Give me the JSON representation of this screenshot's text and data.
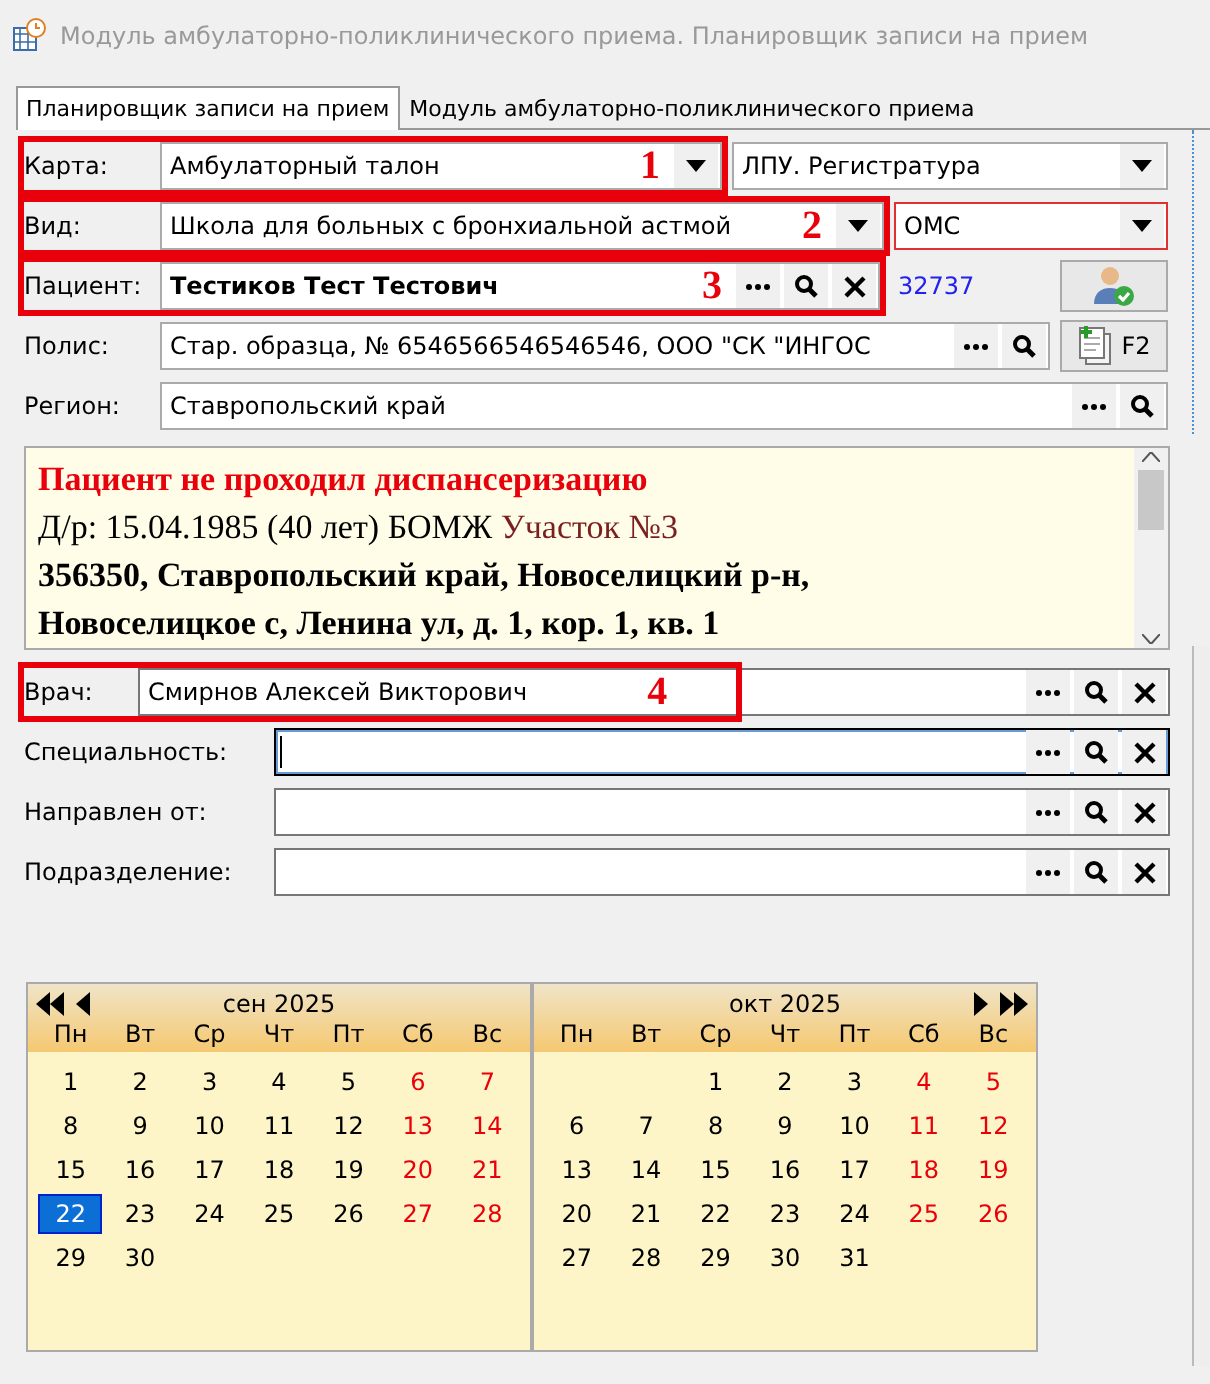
{
  "window": {
    "title": "Модуль амбулаторно-поликлинического приема. Планировщик записи на прием"
  },
  "tabs": [
    {
      "label": "Планировщик записи на прием",
      "selected": true
    },
    {
      "label": "Модуль амбулаторно-поликлинического приема",
      "selected": false
    }
  ],
  "top_rows": [
    {
      "label": "Карта:",
      "kind": "combo",
      "value": "Амбулаторный талон",
      "bold": false,
      "marker": "1",
      "buttons": [],
      "side": {
        "kind": "combo",
        "value": "ЛПУ. Регистратура",
        "error": false
      }
    },
    {
      "label": "Вид:",
      "kind": "combo",
      "value": "Школа для больных с бронхиальной астмой",
      "bold": false,
      "marker": "2",
      "buttons": [],
      "side": {
        "kind": "combo",
        "value": "ОМС",
        "error": true
      }
    },
    {
      "label": "Пациент:",
      "kind": "lookup",
      "value": "Тестиков Тест Тестович",
      "bold": true,
      "marker": "3",
      "buttons": [
        {
          "kind": "more"
        },
        {
          "kind": "search"
        },
        {
          "kind": "clear"
        }
      ],
      "side": {
        "kind": "link_button",
        "value": "32737"
      }
    },
    {
      "label": "Полис:",
      "kind": "lookup",
      "value": "Стар. образца, № 6546566546546546, ООО \"СК \"ИНГОС",
      "bold": false,
      "buttons": [
        {
          "kind": "more"
        },
        {
          "kind": "search"
        }
      ],
      "side": {
        "kind": "key_button",
        "value": "F2"
      }
    },
    {
      "label": "Регион:",
      "kind": "lookup",
      "value": "Ставропольский край",
      "bold": false,
      "buttons": [
        {
          "kind": "more"
        },
        {
          "kind": "search"
        }
      ]
    }
  ],
  "info": {
    "warning": "Пациент не проходил диспансеризацию",
    "birth": "Д/р: 15.04.1985 (40 лет) БОМЖ",
    "district": "Участок №3",
    "address": "356350, Ставропольский край, Новоселицкий р-н, Новоселицкое с, Ленина ул, д. 1, кор. 1, кв. 1"
  },
  "doctor_rows": [
    {
      "label": "Врач:",
      "value": "Смирнов Алексей Викторович",
      "marker": "4",
      "focused": false,
      "buttons": [
        {
          "kind": "more"
        },
        {
          "kind": "search"
        },
        {
          "kind": "clear"
        }
      ]
    },
    {
      "label": "Специальность:",
      "focused": true,
      "buttons": [
        {
          "kind": "more"
        },
        {
          "kind": "search"
        },
        {
          "kind": "clear"
        }
      ]
    },
    {
      "label": "Направлен от:",
      "focused": false,
      "buttons": [
        {
          "kind": "more"
        },
        {
          "kind": "search"
        },
        {
          "kind": "clear"
        }
      ]
    },
    {
      "label": "Подразделение:",
      "focused": false,
      "buttons": [
        {
          "kind": "more"
        },
        {
          "kind": "search"
        },
        {
          "kind": "clear"
        }
      ]
    }
  ],
  "calendar": {
    "months": [
      {
        "title": "сен 2025",
        "prev_buttons": true,
        "next_buttons": false,
        "weekdays": [
          "Пн",
          "Вт",
          "Ср",
          "Чт",
          "Пт",
          "Сб",
          "Вс"
        ],
        "weeks": [
          [
            {
              "day": "1",
              "selected": false
            },
            {
              "day": "2",
              "selected": false
            },
            {
              "day": "3",
              "selected": false
            },
            {
              "day": "4",
              "selected": false
            },
            {
              "day": "5",
              "selected": false
            },
            {
              "day": "6",
              "selected": false
            },
            {
              "day": "7",
              "selected": false
            }
          ],
          [
            {
              "day": "8",
              "selected": false
            },
            {
              "day": "9",
              "selected": false
            },
            {
              "day": "10",
              "selected": false
            },
            {
              "day": "11",
              "selected": false
            },
            {
              "day": "12",
              "selected": false
            },
            {
              "day": "13",
              "selected": false
            },
            {
              "day": "14",
              "selected": false
            }
          ],
          [
            {
              "day": "15",
              "selected": false
            },
            {
              "day": "16",
              "selected": false
            },
            {
              "day": "17",
              "selected": false
            },
            {
              "day": "18",
              "selected": false
            },
            {
              "day": "19",
              "selected": false
            },
            {
              "day": "20",
              "selected": false
            },
            {
              "day": "21",
              "selected": false
            }
          ],
          [
            {
              "day": "22",
              "selected": true
            },
            {
              "day": "23",
              "selected": false
            },
            {
              "day": "24",
              "selected": false
            },
            {
              "day": "25",
              "selected": false
            },
            {
              "day": "26",
              "selected": false
            },
            {
              "day": "27",
              "selected": false
            },
            {
              "day": "28",
              "selected": false
            }
          ],
          [
            {
              "day": "29",
              "selected": false
            },
            {
              "day": "30",
              "selected": false
            }
          ]
        ]
      },
      {
        "title": "окт 2025",
        "prev_buttons": false,
        "next_buttons": true,
        "weekdays": [
          "Пн",
          "Вт",
          "Ср",
          "Чт",
          "Пт",
          "Сб",
          "Вс"
        ],
        "weeks": [
          [
            {
              "day": "1",
              "selected": false
            },
            {
              "day": "2",
              "selected": false
            },
            {
              "day": "3",
              "selected": false
            },
            {
              "day": "4",
              "selected": false
            },
            {
              "day": "5",
              "selected": false
            }
          ],
          [
            {
              "day": "6",
              "selected": false
            },
            {
              "day": "7",
              "selected": false
            },
            {
              "day": "8",
              "selected": false
            },
            {
              "day": "9",
              "selected": false
            },
            {
              "day": "10",
              "selected": false
            },
            {
              "day": "11",
              "selected": false
            },
            {
              "day": "12",
              "selected": false
            }
          ],
          [
            {
              "day": "13",
              "selected": false
            },
            {
              "day": "14",
              "selected": false
            },
            {
              "day": "15",
              "selected": false
            },
            {
              "day": "16",
              "selected": false
            },
            {
              "day": "17",
              "selected": false
            },
            {
              "day": "18",
              "selected": false
            },
            {
              "day": "19",
              "selected": false
            }
          ],
          [
            {
              "day": "20",
              "selected": false
            },
            {
              "day": "21",
              "selected": false
            },
            {
              "day": "22",
              "selected": false
            },
            {
              "day": "23",
              "selected": false
            },
            {
              "day": "24",
              "selected": false
            },
            {
              "day": "25",
              "selected": false
            },
            {
              "day": "26",
              "selected": false
            }
          ],
          [
            {
              "day": "27",
              "selected": false
            },
            {
              "day": "28",
              "selected": false
            },
            {
              "day": "29",
              "selected": false
            },
            {
              "day": "30",
              "selected": false
            },
            {
              "day": "31",
              "selected": false
            }
          ]
        ]
      }
    ]
  }
}
